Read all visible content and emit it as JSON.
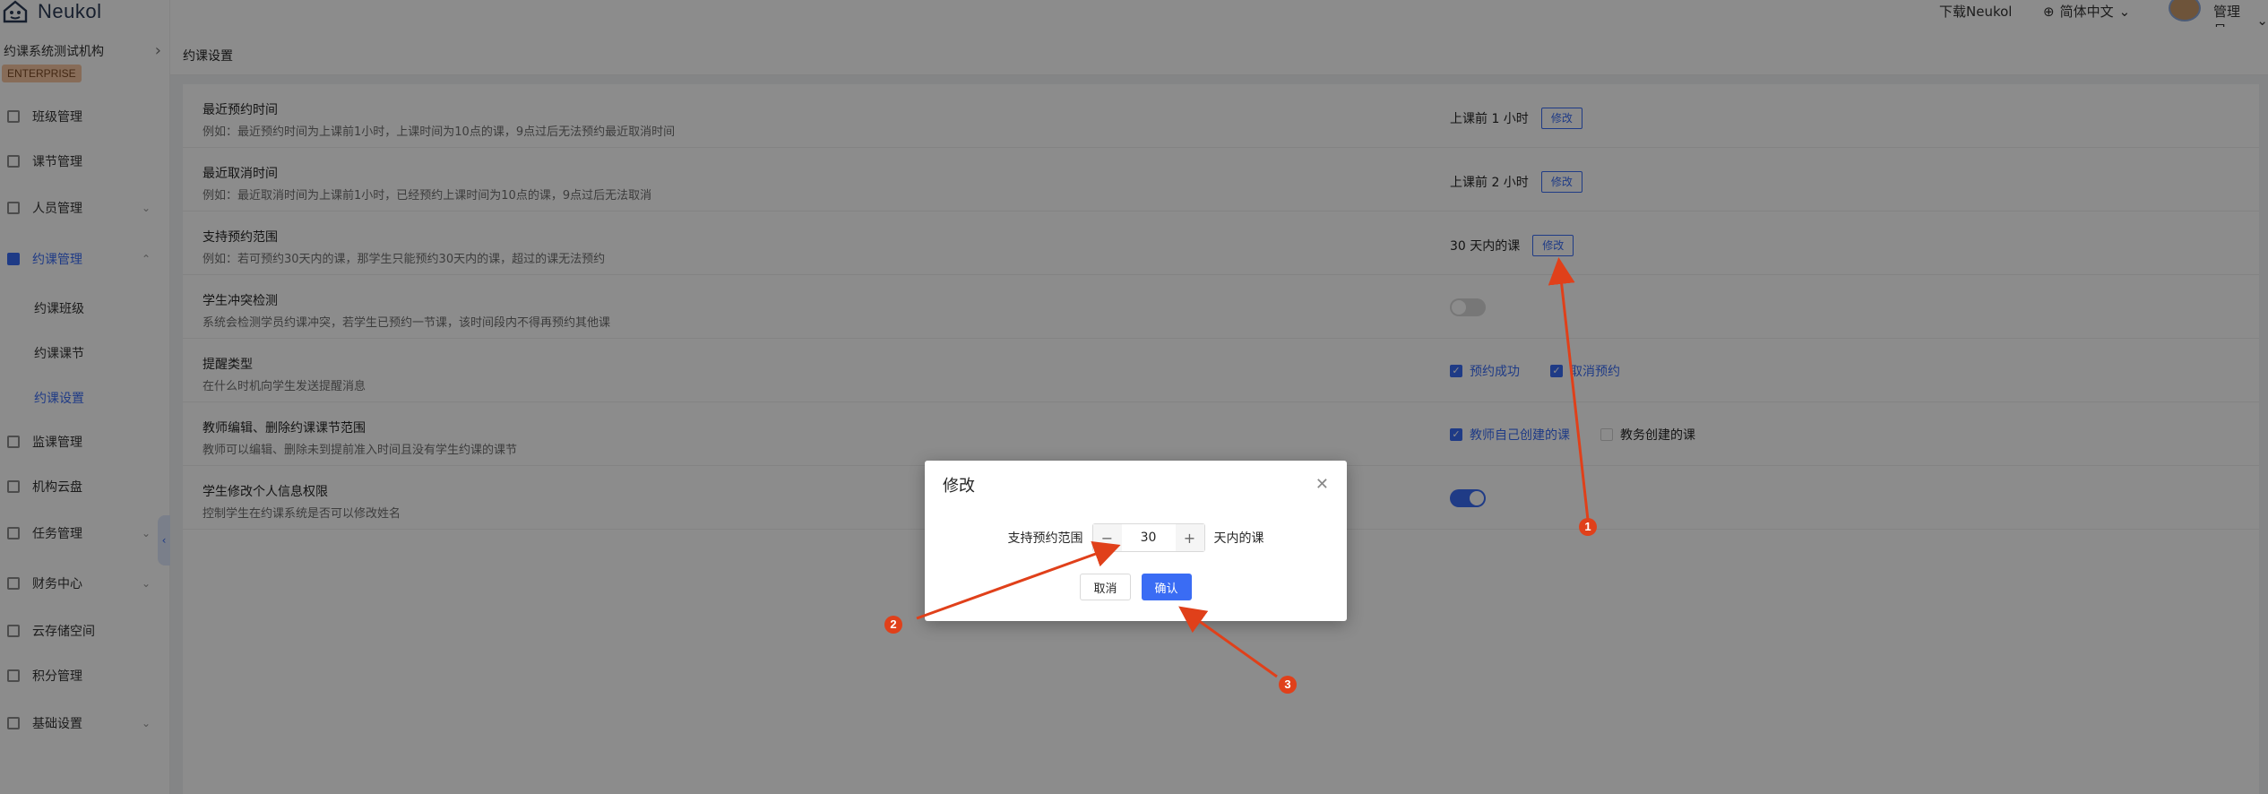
{
  "brand": {
    "name": "Neukol"
  },
  "topbar": {
    "download": "下载Neukol",
    "language": "简体中文",
    "user": "管理员"
  },
  "sidebar": {
    "org_name": "约课系统测试机构",
    "badge": "ENTERPRISE",
    "items": [
      {
        "label": "班级管理"
      },
      {
        "label": "课节管理"
      },
      {
        "label": "人员管理"
      },
      {
        "label": "约课管理"
      },
      {
        "label": "监课管理"
      },
      {
        "label": "机构云盘"
      },
      {
        "label": "任务管理"
      },
      {
        "label": "财务中心"
      },
      {
        "label": "云存储空间"
      },
      {
        "label": "积分管理"
      },
      {
        "label": "基础设置"
      }
    ],
    "sub_items": [
      {
        "label": "约课班级"
      },
      {
        "label": "约课课节"
      },
      {
        "label": "约课设置"
      }
    ]
  },
  "page": {
    "title": "约课设置"
  },
  "settings": [
    {
      "title": "最近预约时间",
      "desc": "例如：最近预约时间为上课前1小时，上课时间为10点的课，9点过后无法预约最近取消时间",
      "value": "上课前 1 小时",
      "action": "修改"
    },
    {
      "title": "最近取消时间",
      "desc": "例如：最近取消时间为上课前1小时，已经预约上课时间为10点的课，9点过后无法取消",
      "value": "上课前 2 小时",
      "action": "修改"
    },
    {
      "title": "支持预约范围",
      "desc": "例如：若可预约30天内的课，那学生只能预约30天内的课，超过的课无法预约",
      "value": "30 天内的课",
      "action": "修改"
    },
    {
      "title": "学生冲突检测",
      "desc": "系统会检测学员约课冲突，若学生已预约一节课，该时间段内不得再预约其他课",
      "toggle": false
    },
    {
      "title": "提醒类型",
      "desc": "在什么时机向学生发送提醒消息",
      "checks": [
        {
          "label": "预约成功",
          "checked": true
        },
        {
          "label": "取消预约",
          "checked": true
        }
      ]
    },
    {
      "title": "教师编辑、删除约课课节范围",
      "desc": "教师可以编辑、删除未到提前准入时间且没有学生约课的课节",
      "checks": [
        {
          "label": "教师自己创建的课",
          "checked": true
        },
        {
          "label": "教务创建的课",
          "checked": false
        }
      ]
    },
    {
      "title": "学生修改个人信息权限",
      "desc": "控制学生在约课系统是否可以修改姓名",
      "toggle": true
    }
  ],
  "modal": {
    "title": "修改",
    "field_label": "支持预约范围",
    "value": "30",
    "suffix": "天内的课",
    "decrement": "−",
    "increment": "+",
    "cancel": "取消",
    "confirm": "确认"
  },
  "annotations": {
    "markers": [
      "1",
      "2",
      "3"
    ],
    "color": "#e0401a"
  },
  "colors": {
    "primary": "#3a6cf4",
    "overlay": "rgba(0,0,0,0.45)"
  }
}
